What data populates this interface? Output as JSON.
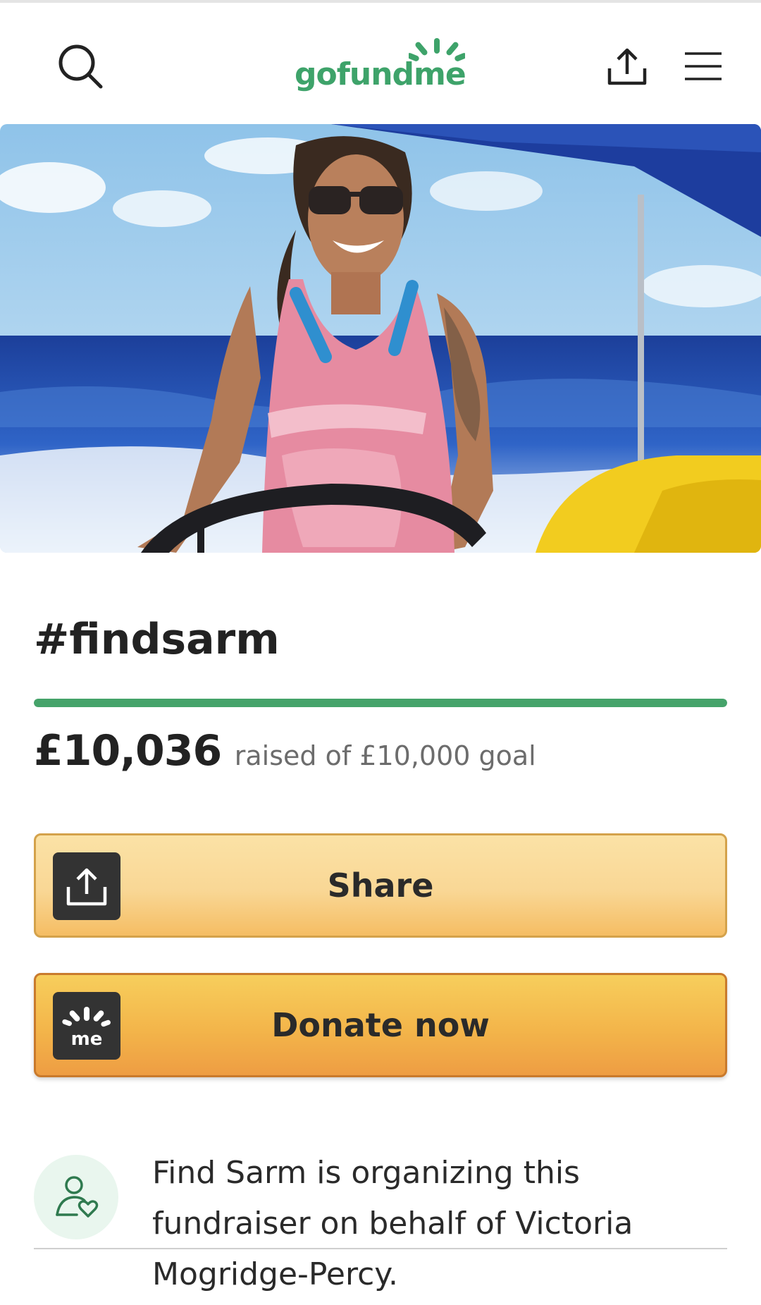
{
  "header": {
    "logo_text": "gofundme",
    "icons": {
      "search": "search-icon",
      "share": "share-icon",
      "menu": "hamburger-menu-icon"
    },
    "brand_color": "#3ea36a"
  },
  "campaign": {
    "title": "#findsarm",
    "hero_image": "woman-sailing-photo",
    "raised_amount": "£10,036",
    "goal_text": "raised of £10,000 goal",
    "progress_percent": 100
  },
  "actions": {
    "share_label": "Share",
    "donate_label": "Donate now",
    "share_icon": "share-icon",
    "donate_icon": "gofundme-me-icon"
  },
  "organizer": {
    "text": "Find Sarm is organizing this fundraiser on behalf of Victoria Mogridge-Percy.",
    "avatar_icon": "organizer-heart-icon"
  }
}
